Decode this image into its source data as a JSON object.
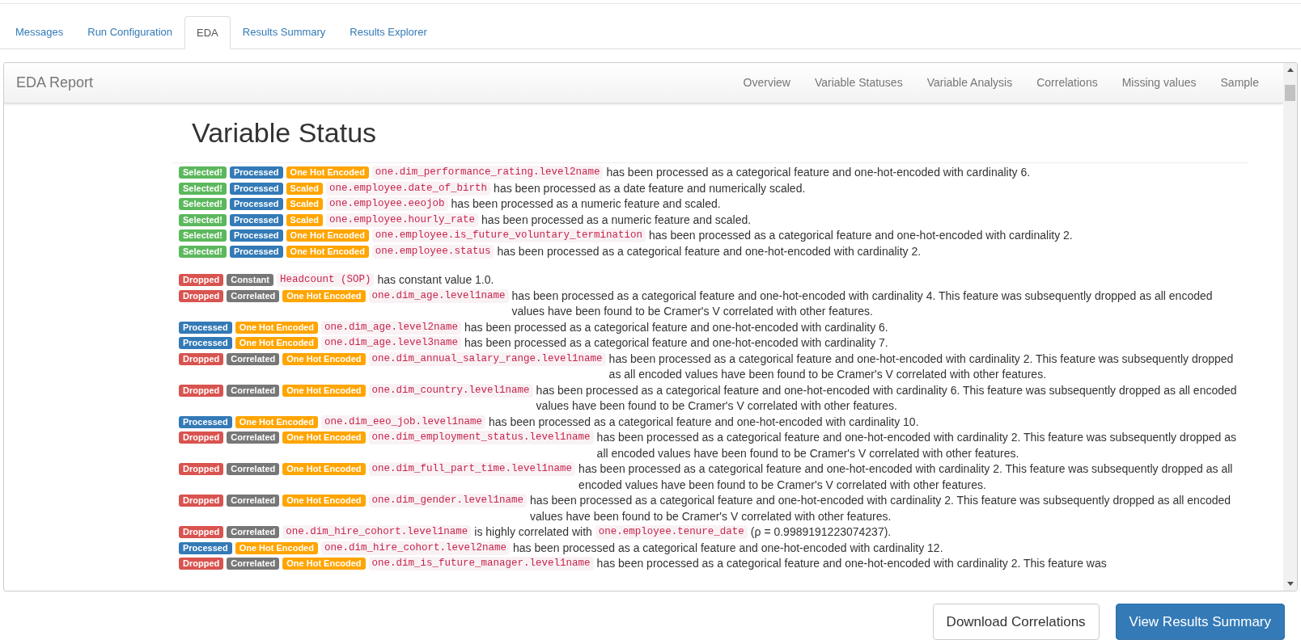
{
  "tabs": [
    {
      "label": "Messages",
      "selected": false
    },
    {
      "label": "Run Configuration",
      "selected": false
    },
    {
      "label": "EDA",
      "selected": true
    },
    {
      "label": "Results Summary",
      "selected": false
    },
    {
      "label": "Results Explorer",
      "selected": false
    }
  ],
  "report": {
    "title": "EDA Report",
    "nav": [
      "Overview",
      "Variable Statuses",
      "Variable Analysis",
      "Correlations",
      "Missing values",
      "Sample"
    ],
    "heading": "Variable Status",
    "groups": [
      [
        {
          "badges": [
            {
              "label": "Selected!",
              "color": "#5cb85c"
            },
            {
              "label": "Processed",
              "color": "#337ab7"
            },
            {
              "label": "One Hot Encoded",
              "color": "#ffa500"
            }
          ],
          "parts": [
            {
              "kind": "code",
              "text": "one.dim_performance_rating.level2name"
            },
            {
              "kind": "text",
              "text": "has been processed as a categorical feature and one-hot-encoded with cardinality 6."
            }
          ]
        },
        {
          "badges": [
            {
              "label": "Selected!",
              "color": "#5cb85c"
            },
            {
              "label": "Processed",
              "color": "#337ab7"
            },
            {
              "label": "Scaled",
              "color": "#ffa500"
            }
          ],
          "parts": [
            {
              "kind": "code",
              "text": "one.employee.date_of_birth"
            },
            {
              "kind": "text",
              "text": "has been processed as a date feature and numerically scaled."
            }
          ]
        },
        {
          "badges": [
            {
              "label": "Selected!",
              "color": "#5cb85c"
            },
            {
              "label": "Processed",
              "color": "#337ab7"
            },
            {
              "label": "Scaled",
              "color": "#ffa500"
            }
          ],
          "parts": [
            {
              "kind": "code",
              "text": "one.employee.eeojob"
            },
            {
              "kind": "text",
              "text": "has been processed as a numeric feature and scaled."
            }
          ]
        },
        {
          "badges": [
            {
              "label": "Selected!",
              "color": "#5cb85c"
            },
            {
              "label": "Processed",
              "color": "#337ab7"
            },
            {
              "label": "Scaled",
              "color": "#ffa500"
            }
          ],
          "parts": [
            {
              "kind": "code",
              "text": "one.employee.hourly_rate"
            },
            {
              "kind": "text",
              "text": "has been processed as a numeric feature and scaled."
            }
          ]
        },
        {
          "badges": [
            {
              "label": "Selected!",
              "color": "#5cb85c"
            },
            {
              "label": "Processed",
              "color": "#337ab7"
            },
            {
              "label": "One Hot Encoded",
              "color": "#ffa500"
            }
          ],
          "parts": [
            {
              "kind": "code",
              "text": "one.employee.is_future_voluntary_termination"
            },
            {
              "kind": "text",
              "text": "has been processed as a categorical feature and one-hot-encoded with cardinality 2."
            }
          ]
        },
        {
          "badges": [
            {
              "label": "Selected!",
              "color": "#5cb85c"
            },
            {
              "label": "Processed",
              "color": "#337ab7"
            },
            {
              "label": "One Hot Encoded",
              "color": "#ffa500"
            }
          ],
          "parts": [
            {
              "kind": "code",
              "text": "one.employee.status"
            },
            {
              "kind": "text",
              "text": "has been processed as a categorical feature and one-hot-encoded with cardinality 2."
            }
          ]
        }
      ],
      [
        {
          "badges": [
            {
              "label": "Dropped",
              "color": "#d9534f"
            },
            {
              "label": "Constant",
              "color": "#777777"
            }
          ],
          "parts": [
            {
              "kind": "code",
              "text": "Headcount (SOP)"
            },
            {
              "kind": "text",
              "text": "has constant value 1.0."
            }
          ]
        },
        {
          "badges": [
            {
              "label": "Dropped",
              "color": "#d9534f"
            },
            {
              "label": "Correlated",
              "color": "#777777"
            },
            {
              "label": "One Hot Encoded",
              "color": "#ffa500"
            }
          ],
          "parts": [
            {
              "kind": "code",
              "text": "one.dim_age.level1name"
            },
            {
              "kind": "text",
              "text": "has been processed as a categorical feature and one-hot-encoded with cardinality 4. This feature was subsequently dropped as all encoded values have been found to be Cramer's V correlated with other features."
            }
          ]
        },
        {
          "badges": [
            {
              "label": "Processed",
              "color": "#337ab7"
            },
            {
              "label": "One Hot Encoded",
              "color": "#ffa500"
            }
          ],
          "parts": [
            {
              "kind": "code",
              "text": "one.dim_age.level2name"
            },
            {
              "kind": "text",
              "text": "has been processed as a categorical feature and one-hot-encoded with cardinality 6."
            }
          ]
        },
        {
          "badges": [
            {
              "label": "Processed",
              "color": "#337ab7"
            },
            {
              "label": "One Hot Encoded",
              "color": "#ffa500"
            }
          ],
          "parts": [
            {
              "kind": "code",
              "text": "one.dim_age.level3name"
            },
            {
              "kind": "text",
              "text": "has been processed as a categorical feature and one-hot-encoded with cardinality 7."
            }
          ]
        },
        {
          "badges": [
            {
              "label": "Dropped",
              "color": "#d9534f"
            },
            {
              "label": "Correlated",
              "color": "#777777"
            },
            {
              "label": "One Hot Encoded",
              "color": "#ffa500"
            }
          ],
          "parts": [
            {
              "kind": "code",
              "text": "one.dim_annual_salary_range.level1name"
            },
            {
              "kind": "text",
              "text": "has been processed as a categorical feature and one-hot-encoded with cardinality 2. This feature was subsequently dropped as all encoded values have been found to be Cramer's V correlated with other features."
            }
          ]
        },
        {
          "badges": [
            {
              "label": "Dropped",
              "color": "#d9534f"
            },
            {
              "label": "Correlated",
              "color": "#777777"
            },
            {
              "label": "One Hot Encoded",
              "color": "#ffa500"
            }
          ],
          "parts": [
            {
              "kind": "code",
              "text": "one.dim_country.level1name"
            },
            {
              "kind": "text",
              "text": "has been processed as a categorical feature and one-hot-encoded with cardinality 6. This feature was subsequently dropped as all encoded values have been found to be Cramer's V correlated with other features."
            }
          ]
        },
        {
          "badges": [
            {
              "label": "Processed",
              "color": "#337ab7"
            },
            {
              "label": "One Hot Encoded",
              "color": "#ffa500"
            }
          ],
          "parts": [
            {
              "kind": "code",
              "text": "one.dim_eeo_job.level1name"
            },
            {
              "kind": "text",
              "text": "has been processed as a categorical feature and one-hot-encoded with cardinality 10."
            }
          ]
        },
        {
          "badges": [
            {
              "label": "Dropped",
              "color": "#d9534f"
            },
            {
              "label": "Correlated",
              "color": "#777777"
            },
            {
              "label": "One Hot Encoded",
              "color": "#ffa500"
            }
          ],
          "parts": [
            {
              "kind": "code",
              "text": "one.dim_employment_status.level1name"
            },
            {
              "kind": "text",
              "text": "has been processed as a categorical feature and one-hot-encoded with cardinality 2. This feature was subsequently dropped as all encoded values have been found to be Cramer's V correlated with other features."
            }
          ]
        },
        {
          "badges": [
            {
              "label": "Dropped",
              "color": "#d9534f"
            },
            {
              "label": "Correlated",
              "color": "#777777"
            },
            {
              "label": "One Hot Encoded",
              "color": "#ffa500"
            }
          ],
          "parts": [
            {
              "kind": "code",
              "text": "one.dim_full_part_time.level1name"
            },
            {
              "kind": "text",
              "text": "has been processed as a categorical feature and one-hot-encoded with cardinality 2. This feature was subsequently dropped as all encoded values have been found to be Cramer's V correlated with other features."
            }
          ]
        },
        {
          "badges": [
            {
              "label": "Dropped",
              "color": "#d9534f"
            },
            {
              "label": "Correlated",
              "color": "#777777"
            },
            {
              "label": "One Hot Encoded",
              "color": "#ffa500"
            }
          ],
          "parts": [
            {
              "kind": "code",
              "text": "one.dim_gender.level1name"
            },
            {
              "kind": "text",
              "text": "has been processed as a categorical feature and one-hot-encoded with cardinality 2. This feature was subsequently dropped as all encoded values have been found to be Cramer's V correlated with other features."
            }
          ]
        },
        {
          "badges": [
            {
              "label": "Dropped",
              "color": "#d9534f"
            },
            {
              "label": "Correlated",
              "color": "#777777"
            }
          ],
          "parts": [
            {
              "kind": "code",
              "text": "one.dim_hire_cohort.level1name"
            },
            {
              "kind": "text",
              "text": "is highly correlated with"
            },
            {
              "kind": "code",
              "text": "one.employee.tenure_date"
            },
            {
              "kind": "text",
              "text": "(ρ = 0.9989191223074237)."
            }
          ]
        },
        {
          "badges": [
            {
              "label": "Processed",
              "color": "#337ab7"
            },
            {
              "label": "One Hot Encoded",
              "color": "#ffa500"
            }
          ],
          "parts": [
            {
              "kind": "code",
              "text": "one.dim_hire_cohort.level2name"
            },
            {
              "kind": "text",
              "text": "has been processed as a categorical feature and one-hot-encoded with cardinality 12."
            }
          ]
        },
        {
          "badges": [
            {
              "label": "Dropped",
              "color": "#d9534f"
            },
            {
              "label": "Correlated",
              "color": "#777777"
            },
            {
              "label": "One Hot Encoded",
              "color": "#ffa500"
            }
          ],
          "parts": [
            {
              "kind": "code",
              "text": "one.dim_is_future_manager.level1name"
            },
            {
              "kind": "text",
              "text": "has been processed as a categorical feature and one-hot-encoded with cardinality 2. This feature was"
            }
          ]
        }
      ]
    ]
  },
  "buttons": [
    {
      "label": "Download Correlations",
      "kind": "secondary"
    },
    {
      "label": "View Results Summary",
      "kind": "primary"
    }
  ]
}
